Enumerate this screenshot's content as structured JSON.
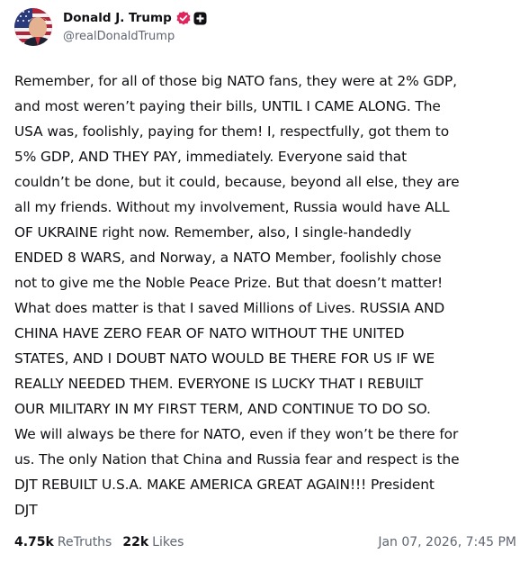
{
  "author": {
    "display_name": "Donald J. Trump",
    "handle": "@realDonaldTrump",
    "verified_icon": "verified-badge-icon",
    "plus_icon": "plus-badge-icon",
    "verified_color": "#e0245e"
  },
  "post": {
    "lines": [
      "Remember, for all of those big NATO fans, they were at 2% GDP,",
      "and most weren’t paying their bills, UNTIL I CAME ALONG. The",
      "USA was, foolishly, paying for them! I, respectfully, got them to",
      "5% GDP, AND THEY PAY, immediately. Everyone said that",
      "couldn’t be done, but it could, because, beyond all else, they are",
      "all my friends. Without my involvement, Russia would have ALL",
      "OF UKRAINE right now. Remember, also, I single-handedly",
      "ENDED 8 WARS, and Norway, a NATO Member, foolishly chose",
      "not to give me the Noble Peace Prize. But that doesn’t matter!",
      "What does matter is that I saved Millions of Lives. RUSSIA AND",
      "CHINA HAVE ZERO FEAR OF NATO WITHOUT THE UNITED",
      "STATES, AND I DOUBT NATO WOULD BE THERE FOR US IF WE",
      "REALLY NEEDED THEM. EVERYONE IS LUCKY THAT I REBUILT",
      "OUR MILITARY IN MY FIRST TERM, AND CONTINUE TO DO SO.",
      "We will always be there for NATO, even if they won’t be there for",
      "us. The only Nation that China and Russia fear and respect is the",
      "DJT REBUILT U.S.A. MAKE AMERICA GREAT AGAIN!!! President",
      "DJT"
    ]
  },
  "stats": {
    "retruths_count": "4.75k",
    "retruths_label": "ReTruths",
    "likes_count": "22k",
    "likes_label": "Likes"
  },
  "timestamp": "Jan 07, 2026, 7:45 PM"
}
